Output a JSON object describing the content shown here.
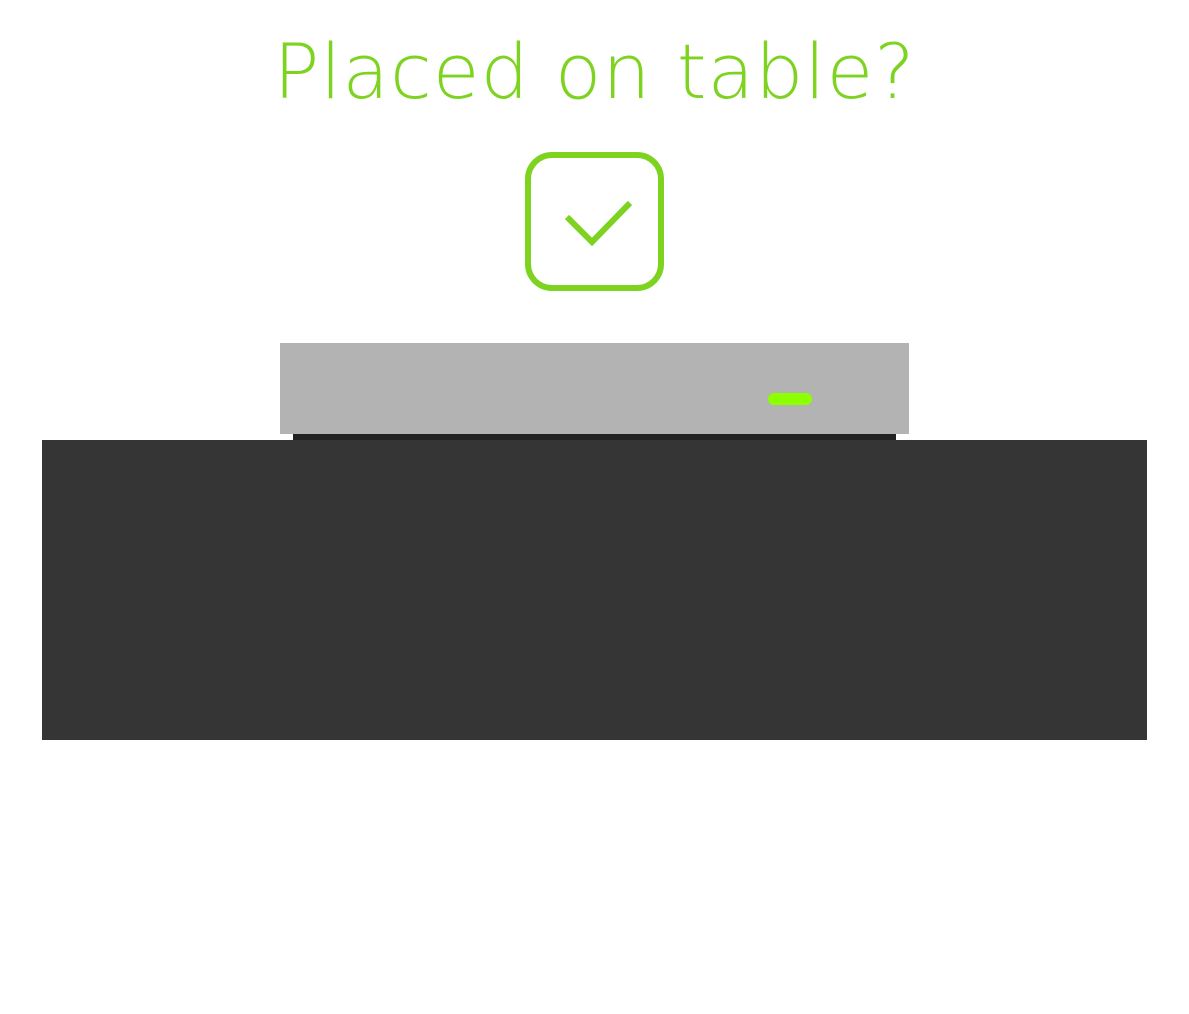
{
  "prompt": {
    "question": "Placed on table?"
  },
  "checkbox": {
    "checked": true,
    "icon": "checkmark-icon"
  },
  "device": {
    "status_led": "on"
  },
  "colors": {
    "accent": "#7ed321",
    "led": "#8cff00",
    "device_body": "#b3b3b3",
    "device_foot": "#222222",
    "table": "#353535",
    "background": "#ffffff"
  }
}
